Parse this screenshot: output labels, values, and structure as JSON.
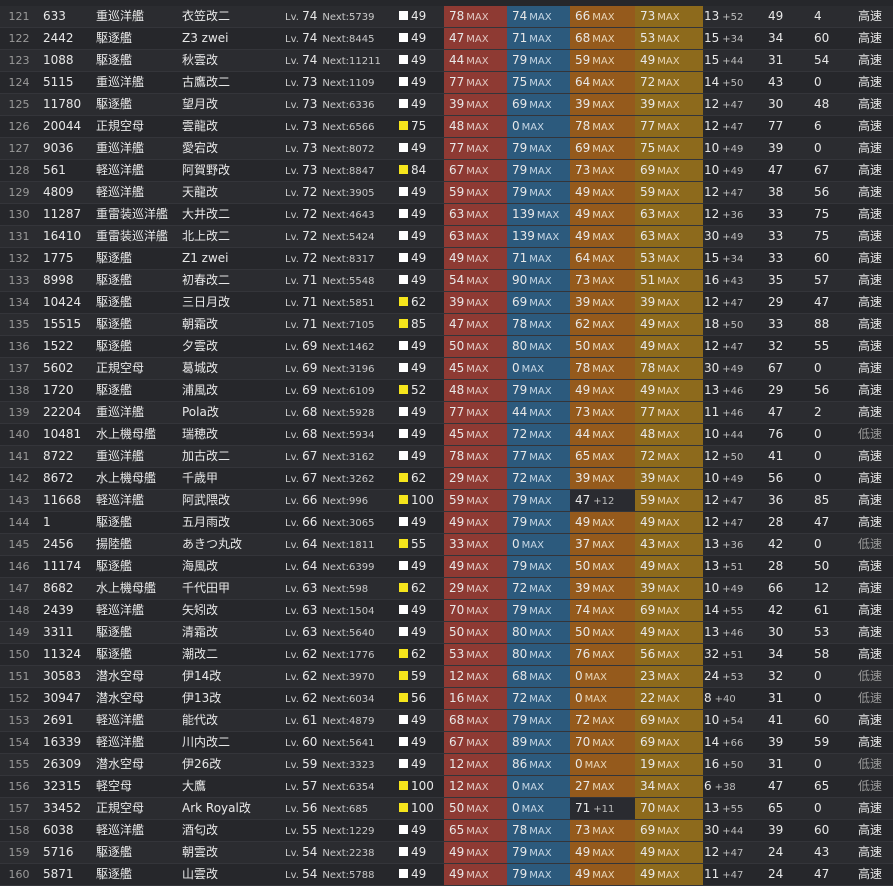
{
  "colors": {
    "firepower": "#8e3a33",
    "torpedo": "#2c5a7d",
    "antiair": "#955a1c",
    "armor": "#8d6a1c",
    "cond_normal": "#ffffff",
    "cond_sparkled": "#f5e51c"
  },
  "labels": {
    "lv": "Lv.",
    "next": "Next:",
    "max": "MAX"
  },
  "rows": [
    {
      "idx": "121",
      "id": "633",
      "type": "重巡洋艦",
      "name": "衣笠改二",
      "lv": "74",
      "next": "5739",
      "cond": "49",
      "cond_color": "white",
      "fp": "78",
      "fp_max": true,
      "tp": "74",
      "tp_max": true,
      "aa": "66",
      "aa_max": true,
      "aa_sub": "",
      "ar": "73",
      "ar_max": true,
      "luk": "13",
      "luk_sub": "+52",
      "asw": "49",
      "los": "4",
      "spd": "高速"
    },
    {
      "idx": "122",
      "id": "2442",
      "type": "駆逐艦",
      "name": "Z3 zwei",
      "lv": "74",
      "next": "8445",
      "cond": "49",
      "cond_color": "white",
      "fp": "47",
      "fp_max": true,
      "tp": "71",
      "tp_max": true,
      "aa": "68",
      "aa_max": true,
      "aa_sub": "",
      "ar": "53",
      "ar_max": true,
      "luk": "15",
      "luk_sub": "+34",
      "asw": "34",
      "los": "60",
      "spd": "高速"
    },
    {
      "idx": "123",
      "id": "1088",
      "type": "駆逐艦",
      "name": "秋雲改",
      "lv": "74",
      "next": "11211",
      "cond": "49",
      "cond_color": "white",
      "fp": "44",
      "fp_max": true,
      "tp": "79",
      "tp_max": true,
      "aa": "59",
      "aa_max": true,
      "aa_sub": "",
      "ar": "49",
      "ar_max": true,
      "luk": "15",
      "luk_sub": "+44",
      "asw": "31",
      "los": "54",
      "spd": "高速"
    },
    {
      "idx": "124",
      "id": "5115",
      "type": "重巡洋艦",
      "name": "古鷹改二",
      "lv": "73",
      "next": "1109",
      "cond": "49",
      "cond_color": "white",
      "fp": "77",
      "fp_max": true,
      "tp": "75",
      "tp_max": true,
      "aa": "64",
      "aa_max": true,
      "aa_sub": "",
      "ar": "72",
      "ar_max": true,
      "luk": "14",
      "luk_sub": "+50",
      "asw": "43",
      "los": "0",
      "spd": "高速"
    },
    {
      "idx": "125",
      "id": "11780",
      "type": "駆逐艦",
      "name": "望月改",
      "lv": "73",
      "next": "6336",
      "cond": "49",
      "cond_color": "white",
      "fp": "39",
      "fp_max": true,
      "tp": "69",
      "tp_max": true,
      "aa": "39",
      "aa_max": true,
      "aa_sub": "",
      "ar": "39",
      "ar_max": true,
      "luk": "12",
      "luk_sub": "+47",
      "asw": "30",
      "los": "48",
      "spd": "高速"
    },
    {
      "idx": "126",
      "id": "20044",
      "type": "正規空母",
      "name": "雲龍改",
      "lv": "73",
      "next": "6566",
      "cond": "75",
      "cond_color": "yellow",
      "fp": "48",
      "fp_max": true,
      "tp": "0",
      "tp_max": true,
      "aa": "78",
      "aa_max": true,
      "aa_sub": "",
      "ar": "77",
      "ar_max": true,
      "luk": "12",
      "luk_sub": "+47",
      "asw": "77",
      "los": "6",
      "spd": "高速"
    },
    {
      "idx": "127",
      "id": "9036",
      "type": "重巡洋艦",
      "name": "愛宕改",
      "lv": "73",
      "next": "8072",
      "cond": "49",
      "cond_color": "white",
      "fp": "77",
      "fp_max": true,
      "tp": "79",
      "tp_max": true,
      "aa": "69",
      "aa_max": true,
      "aa_sub": "",
      "ar": "75",
      "ar_max": true,
      "luk": "10",
      "luk_sub": "+49",
      "asw": "39",
      "los": "0",
      "spd": "高速"
    },
    {
      "idx": "128",
      "id": "561",
      "type": "軽巡洋艦",
      "name": "阿賀野改",
      "lv": "73",
      "next": "8847",
      "cond": "84",
      "cond_color": "yellow",
      "fp": "67",
      "fp_max": true,
      "tp": "79",
      "tp_max": true,
      "aa": "73",
      "aa_max": true,
      "aa_sub": "",
      "ar": "69",
      "ar_max": true,
      "luk": "10",
      "luk_sub": "+49",
      "asw": "47",
      "los": "67",
      "spd": "高速"
    },
    {
      "idx": "129",
      "id": "4809",
      "type": "軽巡洋艦",
      "name": "天龍改",
      "lv": "72",
      "next": "3905",
      "cond": "49",
      "cond_color": "white",
      "fp": "59",
      "fp_max": true,
      "tp": "79",
      "tp_max": true,
      "aa": "49",
      "aa_max": true,
      "aa_sub": "",
      "ar": "59",
      "ar_max": true,
      "luk": "12",
      "luk_sub": "+47",
      "asw": "38",
      "los": "56",
      "spd": "高速"
    },
    {
      "idx": "130",
      "id": "11287",
      "type": "重雷装巡洋艦",
      "name": "大井改二",
      "lv": "72",
      "next": "4643",
      "cond": "49",
      "cond_color": "white",
      "fp": "63",
      "fp_max": true,
      "tp": "139",
      "tp_max": true,
      "aa": "49",
      "aa_max": true,
      "aa_sub": "",
      "ar": "63",
      "ar_max": true,
      "luk": "12",
      "luk_sub": "+36",
      "asw": "33",
      "los": "75",
      "spd": "高速"
    },
    {
      "idx": "131",
      "id": "16410",
      "type": "重雷装巡洋艦",
      "name": "北上改二",
      "lv": "72",
      "next": "5424",
      "cond": "49",
      "cond_color": "white",
      "fp": "63",
      "fp_max": true,
      "tp": "139",
      "tp_max": true,
      "aa": "49",
      "aa_max": true,
      "aa_sub": "",
      "ar": "63",
      "ar_max": true,
      "luk": "30",
      "luk_sub": "+49",
      "asw": "33",
      "los": "75",
      "spd": "高速"
    },
    {
      "idx": "132",
      "id": "1775",
      "type": "駆逐艦",
      "name": "Z1 zwei",
      "lv": "72",
      "next": "8317",
      "cond": "49",
      "cond_color": "white",
      "fp": "49",
      "fp_max": true,
      "tp": "71",
      "tp_max": true,
      "aa": "64",
      "aa_max": true,
      "aa_sub": "",
      "ar": "53",
      "ar_max": true,
      "luk": "15",
      "luk_sub": "+34",
      "asw": "33",
      "los": "60",
      "spd": "高速"
    },
    {
      "idx": "133",
      "id": "8998",
      "type": "駆逐艦",
      "name": "初春改二",
      "lv": "71",
      "next": "5548",
      "cond": "49",
      "cond_color": "white",
      "fp": "54",
      "fp_max": true,
      "tp": "90",
      "tp_max": true,
      "aa": "73",
      "aa_max": true,
      "aa_sub": "",
      "ar": "51",
      "ar_max": true,
      "luk": "16",
      "luk_sub": "+43",
      "asw": "35",
      "los": "57",
      "spd": "高速"
    },
    {
      "idx": "134",
      "id": "10424",
      "type": "駆逐艦",
      "name": "三日月改",
      "lv": "71",
      "next": "5851",
      "cond": "62",
      "cond_color": "yellow",
      "fp": "39",
      "fp_max": true,
      "tp": "69",
      "tp_max": true,
      "aa": "39",
      "aa_max": true,
      "aa_sub": "",
      "ar": "39",
      "ar_max": true,
      "luk": "12",
      "luk_sub": "+47",
      "asw": "29",
      "los": "47",
      "spd": "高速"
    },
    {
      "idx": "135",
      "id": "15515",
      "type": "駆逐艦",
      "name": "朝霜改",
      "lv": "71",
      "next": "7105",
      "cond": "85",
      "cond_color": "yellow",
      "fp": "47",
      "fp_max": true,
      "tp": "78",
      "tp_max": true,
      "aa": "62",
      "aa_max": true,
      "aa_sub": "",
      "ar": "49",
      "ar_max": true,
      "luk": "18",
      "luk_sub": "+50",
      "asw": "33",
      "los": "88",
      "spd": "高速"
    },
    {
      "idx": "136",
      "id": "1522",
      "type": "駆逐艦",
      "name": "夕雲改",
      "lv": "69",
      "next": "1462",
      "cond": "49",
      "cond_color": "white",
      "fp": "50",
      "fp_max": true,
      "tp": "80",
      "tp_max": true,
      "aa": "50",
      "aa_max": true,
      "aa_sub": "",
      "ar": "49",
      "ar_max": true,
      "luk": "12",
      "luk_sub": "+47",
      "asw": "32",
      "los": "55",
      "spd": "高速"
    },
    {
      "idx": "137",
      "id": "5602",
      "type": "正規空母",
      "name": "葛城改",
      "lv": "69",
      "next": "3196",
      "cond": "49",
      "cond_color": "white",
      "fp": "45",
      "fp_max": true,
      "tp": "0",
      "tp_max": true,
      "aa": "78",
      "aa_max": true,
      "aa_sub": "",
      "ar": "78",
      "ar_max": true,
      "luk": "30",
      "luk_sub": "+49",
      "asw": "67",
      "los": "0",
      "spd": "高速"
    },
    {
      "idx": "138",
      "id": "1720",
      "type": "駆逐艦",
      "name": "浦風改",
      "lv": "69",
      "next": "6109",
      "cond": "52",
      "cond_color": "yellow",
      "fp": "48",
      "fp_max": true,
      "tp": "79",
      "tp_max": true,
      "aa": "49",
      "aa_max": true,
      "aa_sub": "",
      "ar": "49",
      "ar_max": true,
      "luk": "13",
      "luk_sub": "+46",
      "asw": "29",
      "los": "56",
      "spd": "高速"
    },
    {
      "idx": "139",
      "id": "22204",
      "type": "重巡洋艦",
      "name": "Pola改",
      "lv": "68",
      "next": "5928",
      "cond": "49",
      "cond_color": "white",
      "fp": "77",
      "fp_max": true,
      "tp": "44",
      "tp_max": true,
      "aa": "73",
      "aa_max": true,
      "aa_sub": "",
      "ar": "77",
      "ar_max": true,
      "luk": "11",
      "luk_sub": "+46",
      "asw": "47",
      "los": "2",
      "spd": "高速"
    },
    {
      "idx": "140",
      "id": "10481",
      "type": "水上機母艦",
      "name": "瑞穂改",
      "lv": "68",
      "next": "5934",
      "cond": "49",
      "cond_color": "white",
      "fp": "45",
      "fp_max": true,
      "tp": "72",
      "tp_max": true,
      "aa": "44",
      "aa_max": true,
      "aa_sub": "",
      "ar": "48",
      "ar_max": true,
      "luk": "10",
      "luk_sub": "+44",
      "asw": "76",
      "los": "0",
      "spd": "低速"
    },
    {
      "idx": "141",
      "id": "8722",
      "type": "重巡洋艦",
      "name": "加古改二",
      "lv": "67",
      "next": "3162",
      "cond": "49",
      "cond_color": "white",
      "fp": "78",
      "fp_max": true,
      "tp": "77",
      "tp_max": true,
      "aa": "65",
      "aa_max": true,
      "aa_sub": "",
      "ar": "72",
      "ar_max": true,
      "luk": "12",
      "luk_sub": "+50",
      "asw": "41",
      "los": "0",
      "spd": "高速"
    },
    {
      "idx": "142",
      "id": "8672",
      "type": "水上機母艦",
      "name": "千歳甲",
      "lv": "67",
      "next": "3262",
      "cond": "62",
      "cond_color": "yellow",
      "fp": "29",
      "fp_max": true,
      "tp": "72",
      "tp_max": true,
      "aa": "39",
      "aa_max": true,
      "aa_sub": "",
      "ar": "39",
      "ar_max": true,
      "luk": "10",
      "luk_sub": "+49",
      "asw": "56",
      "los": "0",
      "spd": "高速"
    },
    {
      "idx": "143",
      "id": "11668",
      "type": "軽巡洋艦",
      "name": "阿武隈改",
      "lv": "66",
      "next": "996",
      "cond": "100",
      "cond_color": "yellow",
      "fp": "59",
      "fp_max": true,
      "tp": "79",
      "tp_max": true,
      "aa": "47",
      "aa_max": false,
      "aa_sub": "+12",
      "ar": "59",
      "ar_max": true,
      "luk": "12",
      "luk_sub": "+47",
      "asw": "36",
      "los": "85",
      "spd": "高速"
    },
    {
      "idx": "144",
      "id": "1",
      "type": "駆逐艦",
      "name": "五月雨改",
      "lv": "66",
      "next": "3065",
      "cond": "49",
      "cond_color": "white",
      "fp": "49",
      "fp_max": true,
      "tp": "79",
      "tp_max": true,
      "aa": "49",
      "aa_max": true,
      "aa_sub": "",
      "ar": "49",
      "ar_max": true,
      "luk": "12",
      "luk_sub": "+47",
      "asw": "28",
      "los": "47",
      "spd": "高速"
    },
    {
      "idx": "145",
      "id": "2456",
      "type": "揚陸艦",
      "name": "あきつ丸改",
      "lv": "64",
      "next": "1811",
      "cond": "55",
      "cond_color": "yellow",
      "fp": "33",
      "fp_max": true,
      "tp": "0",
      "tp_max": true,
      "aa": "37",
      "aa_max": true,
      "aa_sub": "",
      "ar": "43",
      "ar_max": true,
      "luk": "13",
      "luk_sub": "+36",
      "asw": "42",
      "los": "0",
      "spd": "低速"
    },
    {
      "idx": "146",
      "id": "11174",
      "type": "駆逐艦",
      "name": "海風改",
      "lv": "64",
      "next": "6399",
      "cond": "49",
      "cond_color": "white",
      "fp": "49",
      "fp_max": true,
      "tp": "79",
      "tp_max": true,
      "aa": "50",
      "aa_max": true,
      "aa_sub": "",
      "ar": "49",
      "ar_max": true,
      "luk": "13",
      "luk_sub": "+51",
      "asw": "28",
      "los": "50",
      "spd": "高速"
    },
    {
      "idx": "147",
      "id": "8682",
      "type": "水上機母艦",
      "name": "千代田甲",
      "lv": "63",
      "next": "598",
      "cond": "62",
      "cond_color": "yellow",
      "fp": "29",
      "fp_max": true,
      "tp": "72",
      "tp_max": true,
      "aa": "39",
      "aa_max": true,
      "aa_sub": "",
      "ar": "39",
      "ar_max": true,
      "luk": "10",
      "luk_sub": "+49",
      "asw": "66",
      "los": "12",
      "spd": "高速"
    },
    {
      "idx": "148",
      "id": "2439",
      "type": "軽巡洋艦",
      "name": "矢矧改",
      "lv": "63",
      "next": "1504",
      "cond": "49",
      "cond_color": "white",
      "fp": "70",
      "fp_max": true,
      "tp": "79",
      "tp_max": true,
      "aa": "74",
      "aa_max": true,
      "aa_sub": "",
      "ar": "69",
      "ar_max": true,
      "luk": "14",
      "luk_sub": "+55",
      "asw": "42",
      "los": "61",
      "spd": "高速"
    },
    {
      "idx": "149",
      "id": "3311",
      "type": "駆逐艦",
      "name": "清霜改",
      "lv": "63",
      "next": "5640",
      "cond": "49",
      "cond_color": "white",
      "fp": "50",
      "fp_max": true,
      "tp": "80",
      "tp_max": true,
      "aa": "50",
      "aa_max": true,
      "aa_sub": "",
      "ar": "49",
      "ar_max": true,
      "luk": "13",
      "luk_sub": "+46",
      "asw": "30",
      "los": "53",
      "spd": "高速"
    },
    {
      "idx": "150",
      "id": "11324",
      "type": "駆逐艦",
      "name": "潮改二",
      "lv": "62",
      "next": "1776",
      "cond": "62",
      "cond_color": "yellow",
      "fp": "53",
      "fp_max": true,
      "tp": "80",
      "tp_max": true,
      "aa": "76",
      "aa_max": true,
      "aa_sub": "",
      "ar": "56",
      "ar_max": true,
      "luk": "32",
      "luk_sub": "+51",
      "asw": "34",
      "los": "58",
      "spd": "高速"
    },
    {
      "idx": "151",
      "id": "30583",
      "type": "潜水空母",
      "name": "伊14改",
      "lv": "62",
      "next": "3970",
      "cond": "59",
      "cond_color": "yellow",
      "fp": "12",
      "fp_max": true,
      "tp": "68",
      "tp_max": true,
      "aa": "0",
      "aa_max": true,
      "aa_sub": "",
      "ar": "23",
      "ar_max": true,
      "luk": "24",
      "luk_sub": "+53",
      "asw": "32",
      "los": "0",
      "spd": "低速"
    },
    {
      "idx": "152",
      "id": "30947",
      "type": "潜水空母",
      "name": "伊13改",
      "lv": "62",
      "next": "6034",
      "cond": "56",
      "cond_color": "yellow",
      "fp": "16",
      "fp_max": true,
      "tp": "72",
      "tp_max": true,
      "aa": "0",
      "aa_max": true,
      "aa_sub": "",
      "ar": "22",
      "ar_max": true,
      "luk": "8",
      "luk_sub": "+40",
      "asw": "31",
      "los": "0",
      "spd": "低速"
    },
    {
      "idx": "153",
      "id": "2691",
      "type": "軽巡洋艦",
      "name": "能代改",
      "lv": "61",
      "next": "4879",
      "cond": "49",
      "cond_color": "white",
      "fp": "68",
      "fp_max": true,
      "tp": "79",
      "tp_max": true,
      "aa": "72",
      "aa_max": true,
      "aa_sub": "",
      "ar": "69",
      "ar_max": true,
      "luk": "10",
      "luk_sub": "+54",
      "asw": "41",
      "los": "60",
      "spd": "高速"
    },
    {
      "idx": "154",
      "id": "16339",
      "type": "軽巡洋艦",
      "name": "川内改二",
      "lv": "60",
      "next": "5641",
      "cond": "49",
      "cond_color": "white",
      "fp": "67",
      "fp_max": true,
      "tp": "89",
      "tp_max": true,
      "aa": "70",
      "aa_max": true,
      "aa_sub": "",
      "ar": "69",
      "ar_max": true,
      "luk": "14",
      "luk_sub": "+66",
      "asw": "39",
      "los": "59",
      "spd": "高速"
    },
    {
      "idx": "155",
      "id": "26309",
      "type": "潜水空母",
      "name": "伊26改",
      "lv": "59",
      "next": "3323",
      "cond": "49",
      "cond_color": "white",
      "fp": "12",
      "fp_max": true,
      "tp": "86",
      "tp_max": true,
      "aa": "0",
      "aa_max": true,
      "aa_sub": "",
      "ar": "19",
      "ar_max": true,
      "luk": "16",
      "luk_sub": "+50",
      "asw": "31",
      "los": "0",
      "spd": "低速"
    },
    {
      "idx": "156",
      "id": "32315",
      "type": "軽空母",
      "name": "大鷹",
      "lv": "57",
      "next": "6354",
      "cond": "100",
      "cond_color": "yellow",
      "fp": "12",
      "fp_max": true,
      "tp": "0",
      "tp_max": true,
      "aa": "27",
      "aa_max": true,
      "aa_sub": "",
      "ar": "34",
      "ar_max": true,
      "luk": "6",
      "luk_sub": "+38",
      "asw": "47",
      "los": "65",
      "spd": "低速"
    },
    {
      "idx": "157",
      "id": "33452",
      "type": "正規空母",
      "name": "Ark Royal改",
      "lv": "56",
      "next": "685",
      "cond": "100",
      "cond_color": "yellow",
      "fp": "50",
      "fp_max": true,
      "tp": "0",
      "tp_max": true,
      "aa": "71",
      "aa_max": false,
      "aa_sub": "+11",
      "ar": "70",
      "ar_max": true,
      "luk": "13",
      "luk_sub": "+55",
      "asw": "65",
      "los": "0",
      "spd": "高速"
    },
    {
      "idx": "158",
      "id": "6038",
      "type": "軽巡洋艦",
      "name": "酒匂改",
      "lv": "55",
      "next": "1229",
      "cond": "49",
      "cond_color": "white",
      "fp": "65",
      "fp_max": true,
      "tp": "78",
      "tp_max": true,
      "aa": "73",
      "aa_max": true,
      "aa_sub": "",
      "ar": "69",
      "ar_max": true,
      "luk": "30",
      "luk_sub": "+44",
      "asw": "39",
      "los": "60",
      "spd": "高速"
    },
    {
      "idx": "159",
      "id": "5716",
      "type": "駆逐艦",
      "name": "朝雲改",
      "lv": "54",
      "next": "2238",
      "cond": "49",
      "cond_color": "white",
      "fp": "49",
      "fp_max": true,
      "tp": "79",
      "tp_max": true,
      "aa": "49",
      "aa_max": true,
      "aa_sub": "",
      "ar": "49",
      "ar_max": true,
      "luk": "12",
      "luk_sub": "+47",
      "asw": "24",
      "los": "43",
      "spd": "高速"
    },
    {
      "idx": "160",
      "id": "5871",
      "type": "駆逐艦",
      "name": "山雲改",
      "lv": "54",
      "next": "5788",
      "cond": "49",
      "cond_color": "white",
      "fp": "49",
      "fp_max": true,
      "tp": "79",
      "tp_max": true,
      "aa": "49",
      "aa_max": true,
      "aa_sub": "",
      "ar": "49",
      "ar_max": true,
      "luk": "11",
      "luk_sub": "+47",
      "asw": "24",
      "los": "47",
      "spd": "高速"
    }
  ]
}
